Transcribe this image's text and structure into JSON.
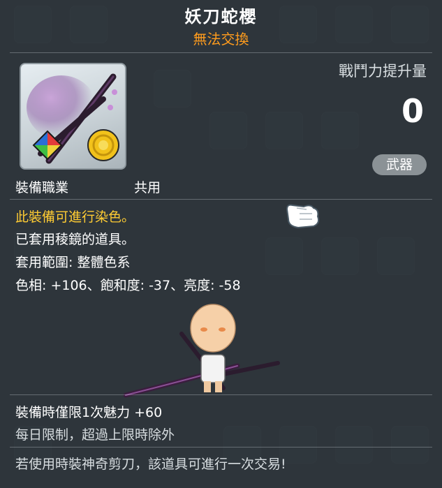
{
  "item": {
    "name": "妖刀蛇櫻",
    "trade_status": "無法交換",
    "icon": "katana-weapon-icon",
    "combat_power_label": "戰鬥力提升量",
    "combat_power_value": "0",
    "type_badge": "武器",
    "job_label": "裝備職業",
    "job_value": "共用"
  },
  "dye": {
    "line1": "此裝備可進行染色。",
    "line2": "已套用稜鏡的道具。",
    "line3": "套用範圍: 整體色系",
    "line4": "色相: +106、飽和度: -37、亮度: -58"
  },
  "footer": {
    "charm_line": "裝備時僅限1次魅力  +60",
    "daily_limit": "每日限制，超過上限時除外",
    "scissors_note": "若使用時裝神奇剪刀，該道具可進行一次交易!"
  },
  "colors": {
    "title": "#ffffff",
    "trade_status": "#ff9c1d",
    "dye_highlight": "#ffcc33",
    "panel": "#283036"
  }
}
